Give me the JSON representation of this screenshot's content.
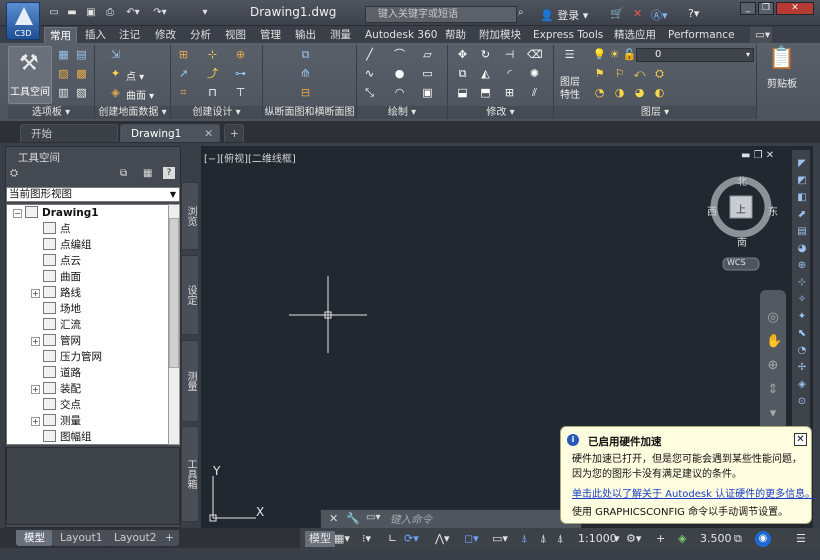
{
  "app": {
    "logo_text": "C3D",
    "doc_title": "Drawing1.dwg"
  },
  "titlebar": {
    "search_placeholder": "键入关键字或短语",
    "user": "登录"
  },
  "ribbon_tabs": [
    "常用",
    "插入",
    "注记",
    "修改",
    "分析",
    "视图",
    "管理",
    "输出",
    "测量",
    "Autodesk 360",
    "帮助",
    "附加模块",
    "Express Tools",
    "精选应用",
    "Performance"
  ],
  "ribbon": {
    "workspace_label": "工具空间",
    "panels": [
      "选项板",
      "创建地面数据",
      "创建设计",
      "纵断面图和横断面图",
      "绘制",
      "修改",
      "图层"
    ],
    "point_label": "点",
    "surface_label": "曲面",
    "layer_value": "0",
    "layer_props": "图层特性",
    "paste_label": "剪贴板"
  },
  "file_tabs": [
    "开始",
    "Drawing1"
  ],
  "toolspace": {
    "title": "工具空间",
    "view_select": "当前图形视图",
    "tree": [
      {
        "label": "Drawing1",
        "level": 0,
        "expander": "minus",
        "bold": true
      },
      {
        "label": "点",
        "level": 1
      },
      {
        "label": "点编组",
        "level": 1
      },
      {
        "label": "点云",
        "level": 1
      },
      {
        "label": "曲面",
        "level": 1
      },
      {
        "label": "路线",
        "level": 1,
        "expander": "plus"
      },
      {
        "label": "场地",
        "level": 1
      },
      {
        "label": "汇流",
        "level": 1
      },
      {
        "label": "管网",
        "level": 1,
        "expander": "plus"
      },
      {
        "label": "压力管网",
        "level": 1
      },
      {
        "label": "道路",
        "level": 1
      },
      {
        "label": "装配",
        "level": 1,
        "expander": "plus"
      },
      {
        "label": "交点",
        "level": 1
      },
      {
        "label": "测量",
        "level": 1,
        "expander": "plus"
      },
      {
        "label": "图幅组",
        "level": 1
      }
    ],
    "side_tabs": [
      "浏览",
      "设定",
      "测量",
      "工具箱"
    ]
  },
  "viewport": {
    "label": "[−][俯视][二维线框]",
    "viewcube": {
      "north": "北",
      "south": "南",
      "east": "东",
      "west": "西",
      "face": "上",
      "wcs": "WCS"
    },
    "ucs_x": "X",
    "ucs_y": "Y"
  },
  "command": {
    "placeholder": "键入命令"
  },
  "layout_tabs": [
    "模型",
    "Layout1",
    "Layout2"
  ],
  "status": {
    "model": "模型",
    "scale": "1:1000",
    "elevation": "3.500"
  },
  "notification": {
    "title": "已启用硬件加速",
    "body": "硬件加速已打开，但是您可能会遇到某些性能问题，因为您的图形卡没有满足建议的条件。",
    "link": "单击此处以了解关于 Autodesk 认证硬件的更多信息。",
    "footer": "使用 GRAPHICSCONFIG 命令以手动调节设置。"
  },
  "colors": {
    "canvas": "#212830",
    "ribbon": "#545a63",
    "accent_link": "#1a3cc8",
    "notif_bg": "#fffde0"
  }
}
